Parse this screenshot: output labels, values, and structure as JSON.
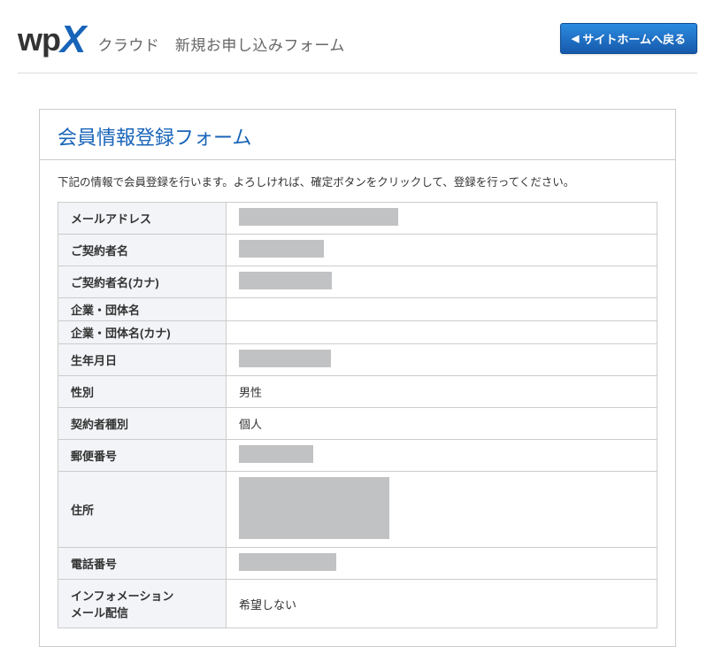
{
  "header": {
    "logo_wp": "wp",
    "logo_x": "X",
    "subtitle": "クラウド　新規お申し込みフォーム",
    "back_button": "サイトホームへ戻る"
  },
  "form": {
    "title": "会員情報登録フォーム",
    "description": "下記の情報で会員登録を行います。よろしければ、確定ボタンをクリックして、登録を行ってください。",
    "rows": [
      {
        "label": "メールアドレス",
        "value": "",
        "redacted_w": 180,
        "redacted_h": 20
      },
      {
        "label": "ご契約者名",
        "value": "",
        "redacted_w": 96,
        "redacted_h": 20
      },
      {
        "label": "ご契約者名(カナ)",
        "value": "",
        "redacted_w": 105,
        "redacted_h": 20
      },
      {
        "label": "企業・団体名",
        "value": "",
        "compact": true
      },
      {
        "label": "企業・団体名(カナ)",
        "value": "",
        "compact": true
      },
      {
        "label": "生年月日",
        "value": "",
        "redacted_w": 104,
        "redacted_h": 20
      },
      {
        "label": "性別",
        "value": "男性"
      },
      {
        "label": "契約者種別",
        "value": "個人"
      },
      {
        "label": "郵便番号",
        "value": "",
        "redacted_w": 84,
        "redacted_h": 20
      },
      {
        "label": "住所",
        "value": "",
        "redacted_w": 170,
        "redacted_h": 70
      },
      {
        "label": "電話番号",
        "value": "",
        "redacted_w": 110,
        "redacted_h": 20
      },
      {
        "label": "インフォメーション\nメール配信",
        "value": "希望しない"
      }
    ]
  }
}
